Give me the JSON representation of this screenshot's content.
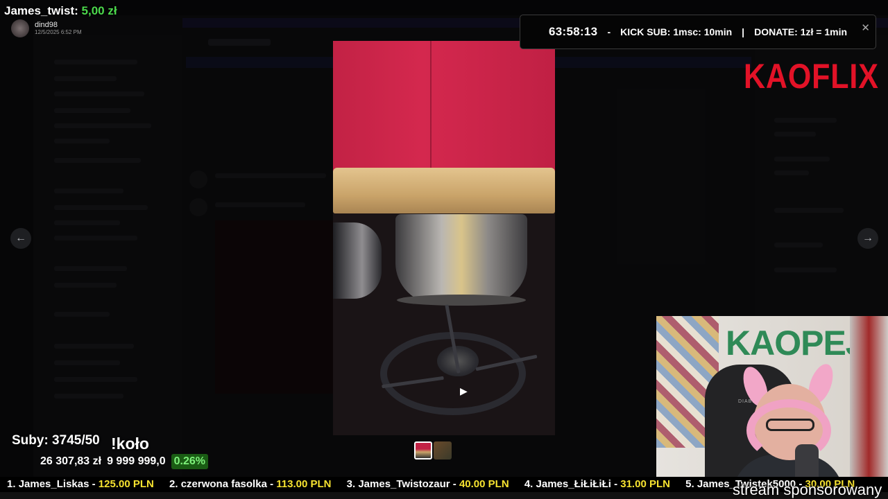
{
  "donation": {
    "name": "James_twist:",
    "amount": "5,00 zł",
    "user": "dind98",
    "time": "12/5/2025 6:52 PM"
  },
  "timer": {
    "clock": "63:58:13",
    "separator1": "-",
    "kick_sub": "KICK SUB: 1msc: 10min",
    "separator2": "|",
    "donate": "DONATE: 1zł = 1min"
  },
  "brand": {
    "logo": "KAOFLIX",
    "color": "#e21227"
  },
  "webcam": {
    "wall_text": "KAOPEJ",
    "chair_label": "DIABLO"
  },
  "subs": {
    "label": "Suby: 3745/50",
    "kolo": "!koło"
  },
  "totals": {
    "collected": "26 307,83 zł",
    "goal": "9 999 999,0",
    "percent": "0.26%"
  },
  "ticker": [
    {
      "rank": "1.",
      "name": "James_Liskas -",
      "amount": "125.00 PLN"
    },
    {
      "rank": "2.",
      "name": "czerwona fasolka -",
      "amount": "113.00 PLN"
    },
    {
      "rank": "3.",
      "name": "James_Twistozaur -",
      "amount": "40.00 PLN"
    },
    {
      "rank": "4.",
      "name": "James_ŁiŁiŁiŁi -",
      "amount": "31.00 PLN"
    },
    {
      "rank": "5.",
      "name": "James_Twistek5000 -",
      "amount": "30.00 PLN"
    }
  ],
  "sponsor": "stream sponsorowany",
  "viewer": {
    "prev_icon": "arrow-left-icon",
    "next_icon": "arrow-right-icon",
    "close_icon": "close-icon"
  }
}
